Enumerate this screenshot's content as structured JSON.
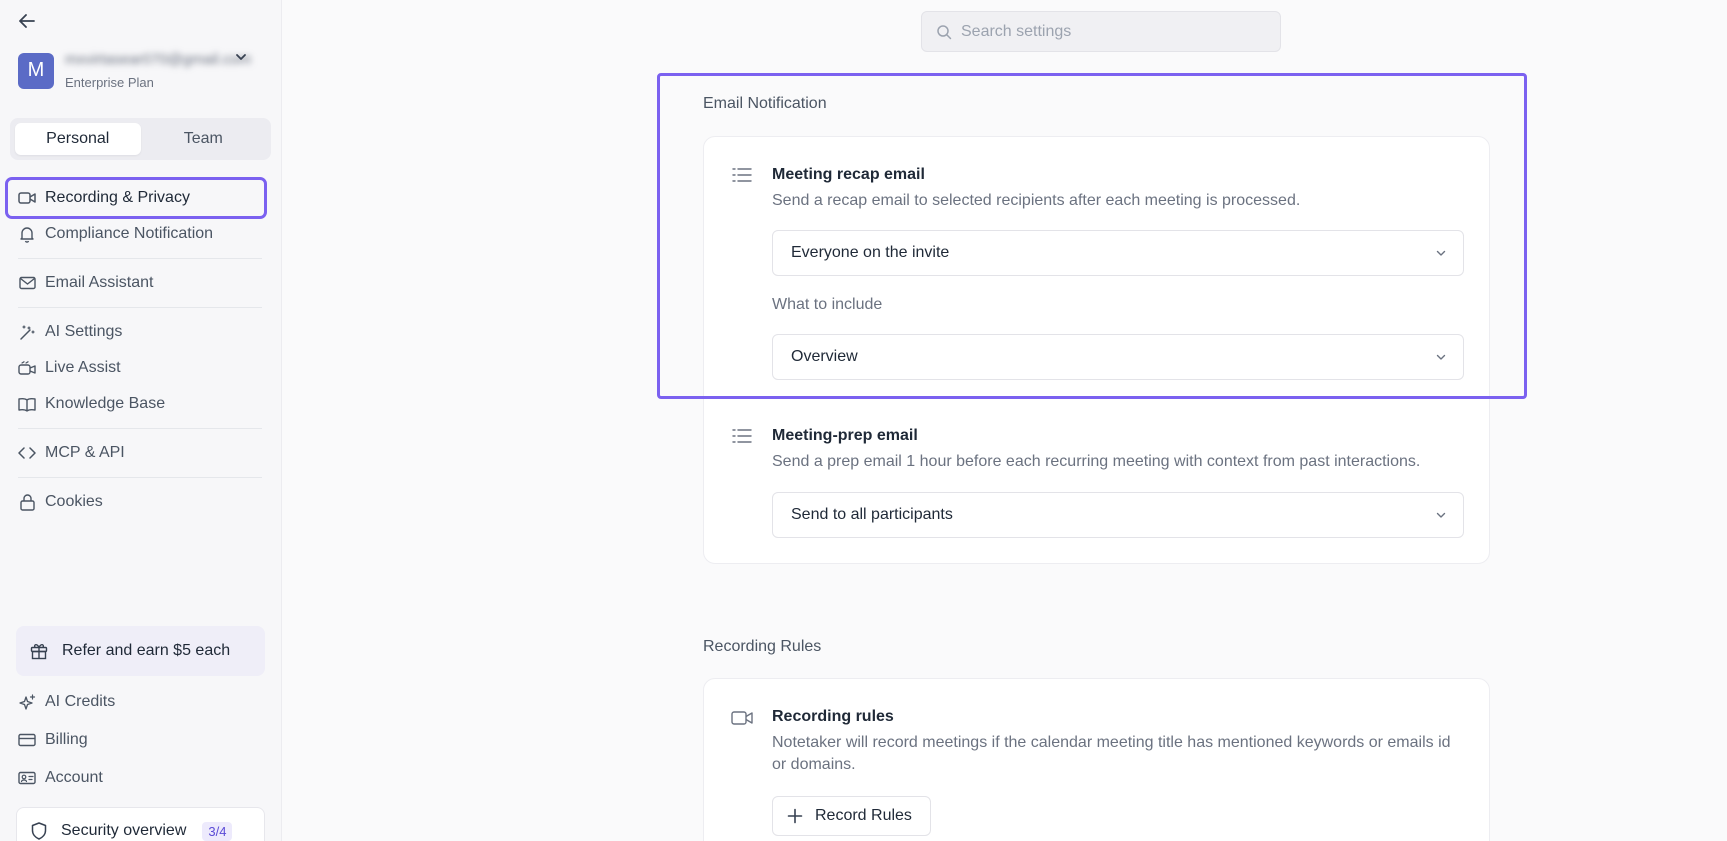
{
  "sidebar": {
    "account": {
      "avatar_letter": "M",
      "email": "mxvirtasear070@gmail.com",
      "plan": "Enterprise Plan"
    },
    "tabs": {
      "personal": "Personal",
      "team": "Team"
    },
    "nav": {
      "recording_privacy": "Recording & Privacy",
      "compliance_notification": "Compliance Notification",
      "email_assistant": "Email Assistant",
      "ai_settings": "AI Settings",
      "live_assist": "Live Assist",
      "knowledge_base": "Knowledge Base",
      "mcp_api": "MCP & API",
      "cookies": "Cookies"
    },
    "refer": "Refer and earn $5 each",
    "bottom": {
      "ai_credits": "AI Credits",
      "billing": "Billing",
      "account": "Account"
    },
    "security": {
      "label": "Security overview",
      "badge": "3/4"
    }
  },
  "search": {
    "placeholder": "Search settings"
  },
  "email_notification": {
    "section_title": "Email Notification",
    "recap": {
      "title": "Meeting recap email",
      "desc": "Send a recap email to selected recipients after each meeting is processed.",
      "recipients_value": "Everyone on the invite",
      "include_label": "What to include",
      "include_value": "Overview"
    },
    "prep": {
      "title": "Meeting-prep email",
      "desc": "Send a prep email 1 hour before each recurring meeting with context from past interactions.",
      "recipients_value": "Send to all participants"
    }
  },
  "recording_rules": {
    "section_title": "Recording Rules",
    "title": "Recording rules",
    "desc": "Notetaker will record meetings if the calendar meeting title has mentioned keywords or emails id or domains.",
    "button": "Record Rules"
  },
  "colors": {
    "accent": "#7b61f0",
    "avatar": "#5b6bc6"
  }
}
